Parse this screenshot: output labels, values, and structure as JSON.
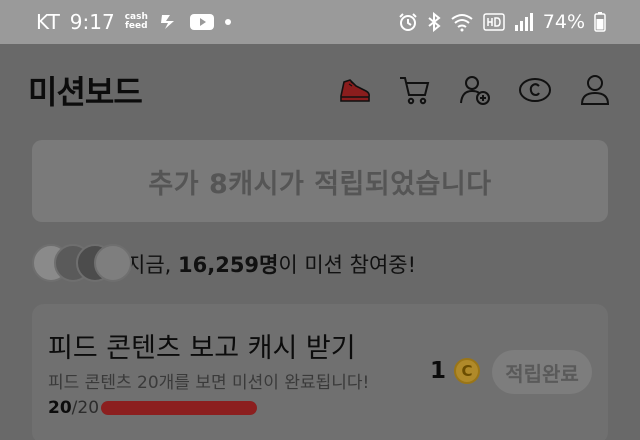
{
  "statusbar": {
    "carrier": "KT",
    "time": "9:17",
    "app_cash_top": "cash",
    "app_cash_bottom": "feed",
    "battery": "74%"
  },
  "header": {
    "title": "미션보드"
  },
  "banner": {
    "text": "추가 8캐시가 적립되었습니다"
  },
  "participants": {
    "prefix": "지금, ",
    "count": "16,259명",
    "suffix": "이 미션 참여중!"
  },
  "mission": {
    "title": "피드 콘텐츠 보고 캐시 받기",
    "description": "피드 콘텐츠 20개를 보면 미션이 완료됩니다!",
    "progress_count": "20",
    "progress_total": "/20",
    "progress_fraction": 1.0,
    "reward": "1",
    "coin_symbol": "C",
    "status_label": "적립완료"
  },
  "colors": {
    "progress": "#8c1f1f",
    "coin": "#b08a2a"
  }
}
